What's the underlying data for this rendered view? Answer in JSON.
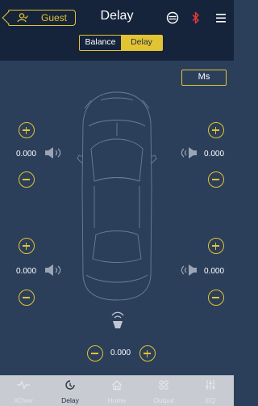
{
  "header": {
    "guest_label": "Guest",
    "title": "Delay"
  },
  "segment": {
    "balance_label": "Balance",
    "delay_label": "Delay"
  },
  "unit_button": "Ms",
  "channels": {
    "front_left": "0.000",
    "front_right": "0.000",
    "rear_left": "0.000",
    "rear_right": "0.000",
    "subwoofer": "0.000"
  },
  "tabs": [
    {
      "label": "XOver",
      "icon": "pulse-icon"
    },
    {
      "label": "Delay",
      "icon": "clock-icon"
    },
    {
      "label": "Home",
      "icon": "home-icon"
    },
    {
      "label": "Output",
      "icon": "grid-icon"
    },
    {
      "label": "EQ",
      "icon": "sliders-icon"
    }
  ],
  "colors": {
    "accent": "#e2c332",
    "header_bg": "#15233b",
    "body_bg": "#2b3f5b",
    "tabbar_bg": "#c8cbd2",
    "bluetooth": "#e03a3a"
  }
}
